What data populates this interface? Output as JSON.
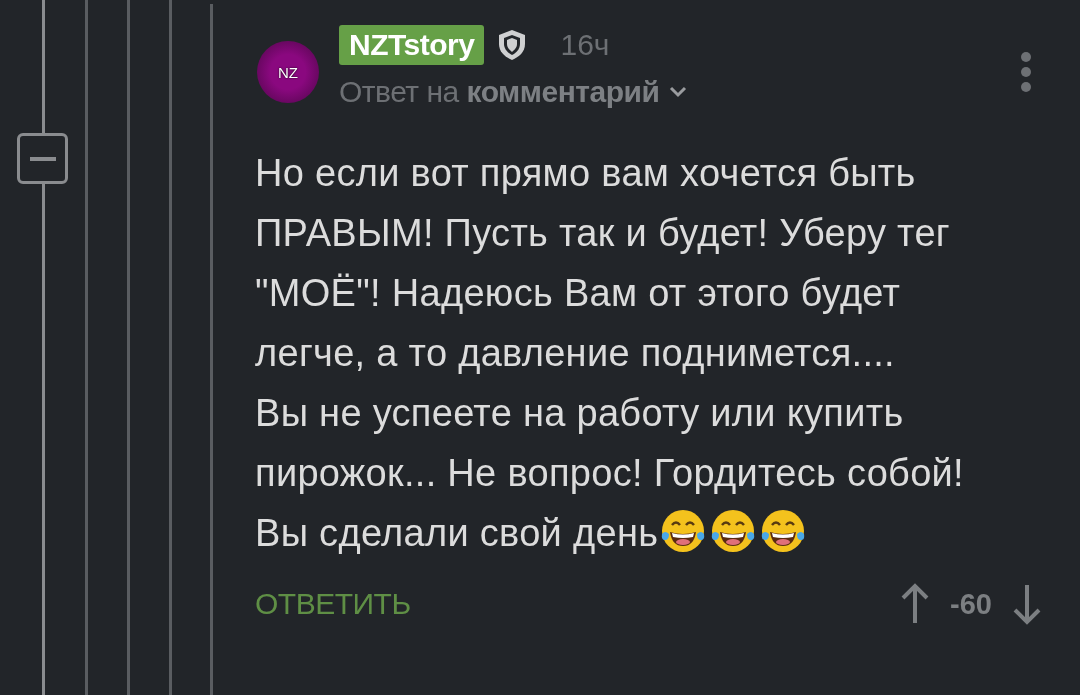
{
  "comment": {
    "avatar": "NZ",
    "author": "NZTstory",
    "time": "16ч",
    "reply_prefix": "Ответ на",
    "reply_target": "комментарий",
    "lines": [
      "Но если вот прямо вам хочется быть",
      "ПРАВЫМ! Пусть так и будет! Уберу тег",
      "\"МОЁ\"! Надеюсь Вам от этого будет",
      "легче, а то давление поднимется....",
      "Вы не успеете на работу или купить",
      "пирожок... Не вопрос! Гордитесь собой!",
      "Вы сделали свой день"
    ],
    "emojis": [
      {
        "kind": "laughing"
      },
      {
        "kind": "laughing"
      },
      {
        "kind": "laughing"
      }
    ],
    "reply_button": "ОТВЕТИТЬ",
    "rating": "-60",
    "collapsed": false
  }
}
